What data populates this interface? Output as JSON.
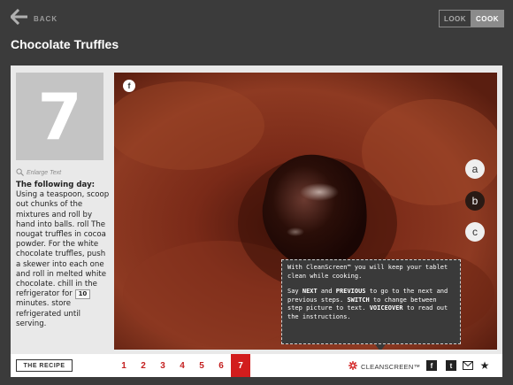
{
  "nav": {
    "back_label": "BACK"
  },
  "mode_toggle": {
    "look_label": "LOOK",
    "cook_label": "COOK",
    "active": "COOK"
  },
  "recipe": {
    "title": "Chocolate Truffles"
  },
  "step": {
    "number": "7",
    "enlarge_label": "Enlarge Text",
    "heading": "The following day:",
    "text_before_timer": "Using a teaspoon, scoop out chunks of the mixtures and roll by hand into balls. roll The nougat truffles in cocoa powder. For the white chocolate truffles, push a skewer into each one and roll in melted white chocolate. chill in the refrigerator for",
    "timer_value": "10",
    "text_after_timer": "minutes. store refrigerated until serving."
  },
  "photo": {
    "fb_badge": "f",
    "choices": [
      "a",
      "b",
      "c"
    ]
  },
  "tooltip": {
    "p1": "With CleanScreen™ you will keep your tablet clean while cooking.",
    "p2_pre": "Say ",
    "p2_next": "NEXT",
    "p2_and": " and ",
    "p2_prev": "PREVIOUS",
    "p2_mid": " to go to the next and previous steps. ",
    "p2_switch": "SWITCH",
    "p2_mid2": " to change between step picture to text. ",
    "p2_voice": "VOICEOVER",
    "p2_end": " to read out the instructions."
  },
  "bottom_bar": {
    "recipe_button": "THE RECIPE",
    "steps": [
      "1",
      "2",
      "3",
      "4",
      "5",
      "6",
      "7"
    ],
    "active_step": "7",
    "cleanscreen_label": "CLEANSCREEN™",
    "social": {
      "facebook": "f",
      "twitter": "t"
    }
  },
  "colors": {
    "accent_red": "#d21d1d",
    "background": "#3b3b3b",
    "panel": "#e9e9e9",
    "cocoa": "#7a2a18"
  },
  "icons": [
    "back-arrow-icon",
    "magnifier-icon",
    "facebook-icon",
    "twitter-icon",
    "mail-icon",
    "star-icon",
    "cleanscreen-icon"
  ]
}
